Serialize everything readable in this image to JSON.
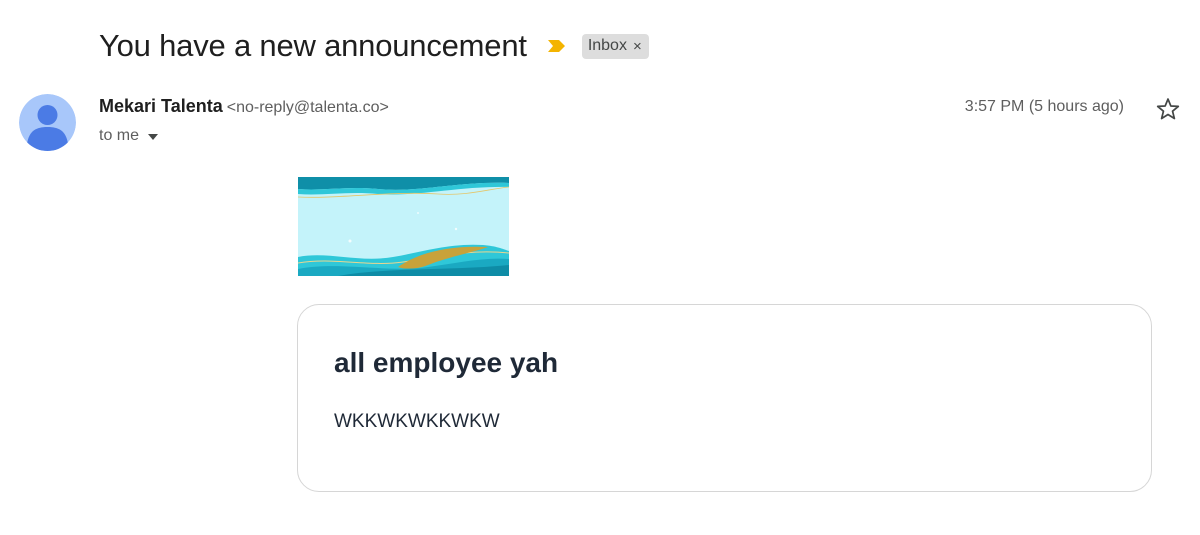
{
  "email": {
    "subject": "You have a new announcement",
    "label": "Inbox",
    "label_remove": "×",
    "sender_name": "Mekari Talenta",
    "sender_email": "<no-reply@talenta.co>",
    "recipient": "to me",
    "timestamp": "3:57 PM (5 hours ago)",
    "icons": {
      "importance": "importance-marker-icon",
      "star": "star-icon",
      "avatar": "default-avatar",
      "recipient_caret": "caret-down-icon"
    },
    "colors": {
      "importance": "#f4b400",
      "avatar_bg": "#a8c7fa",
      "avatar_fg": "#4b7be5"
    }
  },
  "body": {
    "title": "all employee yah",
    "text": "WKKWKWKKWKW"
  }
}
